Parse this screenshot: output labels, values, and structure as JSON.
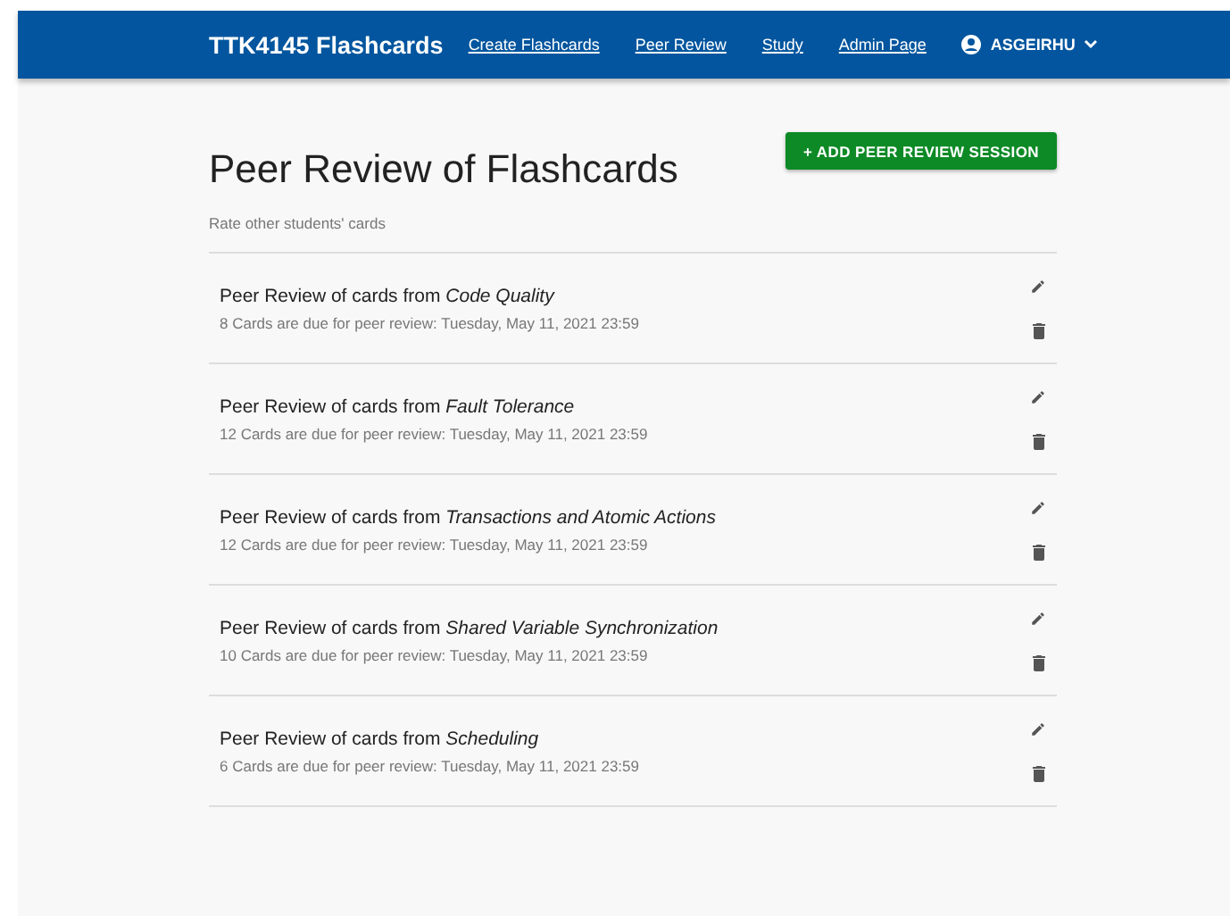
{
  "navbar": {
    "brand": "TTK4145 Flashcards",
    "links": [
      "Create Flashcards",
      "Peer Review",
      "Study",
      "Admin Page"
    ],
    "user": "ASGEIRHU"
  },
  "header": {
    "title": "Peer Review of Flashcards",
    "subtitle": "Rate other students' cards",
    "button": "+ ADD PEER REVIEW SESSION"
  },
  "sessions": [
    {
      "title": "Peer Review of cards from *Code Quality*",
      "due": "8 Cards are due for peer review: Tuesday, May 11, 2021 23:59"
    },
    {
      "title": "Peer Review of cards from *Fault Tolerance*",
      "due": "12 Cards are due for peer review: Tuesday, May 11, 2021 23:59"
    },
    {
      "title": "Peer Review of cards from *Transactions and Atomic Actions*",
      "due": "12 Cards are due for peer review: Tuesday, May 11, 2021 23:59"
    },
    {
      "title": "Peer Review of cards from *Shared Variable Synchronization*",
      "due": "10 Cards are due for peer review: Tuesday, May 11, 2021 23:59"
    },
    {
      "title": "Peer Review of cards from *Scheduling*",
      "due": "6 Cards are due for peer review: Tuesday, May 11, 2021 23:59"
    }
  ]
}
